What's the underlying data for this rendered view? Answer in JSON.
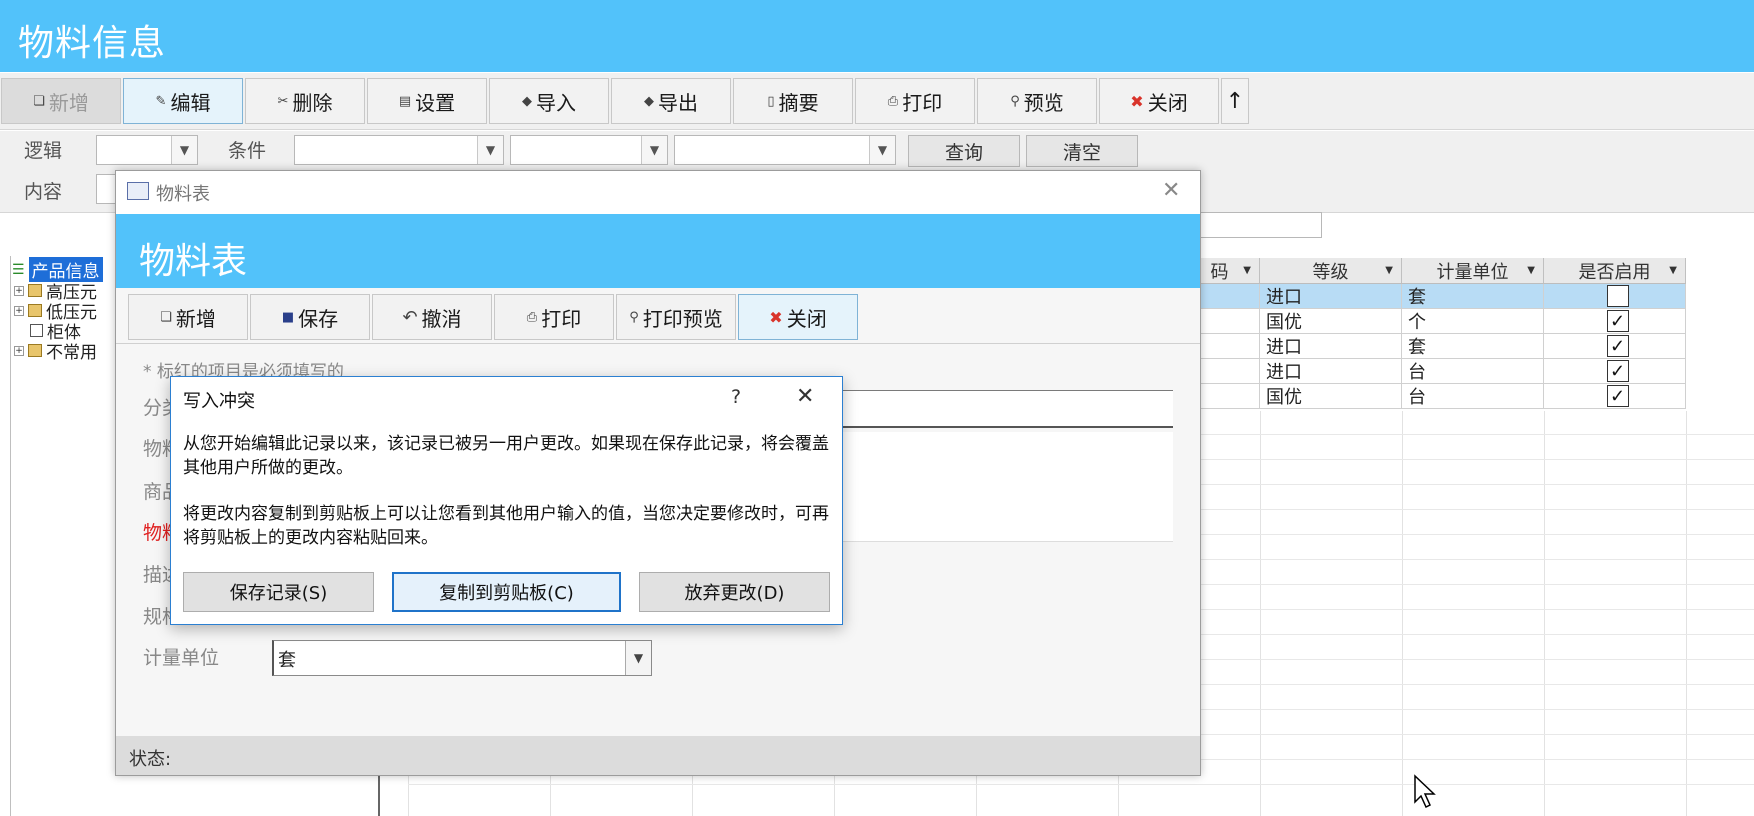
{
  "app": {
    "title": "物料信息"
  },
  "toolbar": {
    "buttons": [
      {
        "label": "新增",
        "icon": "new-icon",
        "glyph": "❏"
      },
      {
        "label": "编辑",
        "icon": "edit-icon",
        "glyph": "✎"
      },
      {
        "label": "删除",
        "icon": "delete-icon",
        "glyph": "✂"
      },
      {
        "label": "设置",
        "icon": "settings-icon",
        "glyph": "▤"
      },
      {
        "label": "导入",
        "icon": "import-icon",
        "glyph": "◆"
      },
      {
        "label": "导出",
        "icon": "export-icon",
        "glyph": "◆"
      },
      {
        "label": "摘要",
        "icon": "summary-icon",
        "glyph": "▯"
      },
      {
        "label": "打印",
        "icon": "print-icon",
        "glyph": "⎙"
      },
      {
        "label": "预览",
        "icon": "preview-icon",
        "glyph": "⚲"
      },
      {
        "label": "关闭",
        "icon": "close-circle-icon",
        "glyph": "✖"
      }
    ],
    "scroll_up": "↑"
  },
  "filter": {
    "logic_label": "逻辑",
    "condition_label": "条件",
    "content_label": "内容",
    "query_button": "查询",
    "clear_button": "清空"
  },
  "tree": {
    "root": "产品信息",
    "items": [
      {
        "label": "高压元",
        "type": "folder",
        "expandable": true
      },
      {
        "label": "低压元",
        "type": "folder",
        "expandable": true
      },
      {
        "label": "柜体",
        "type": "leaf",
        "expandable": false
      },
      {
        "label": "不常用",
        "type": "folder",
        "expandable": true
      }
    ]
  },
  "grid": {
    "columns": [
      "码",
      "等级",
      "计量单位",
      "是否启用"
    ],
    "rows": [
      {
        "grade": "进口",
        "unit": "套",
        "enabled": false,
        "selected": true
      },
      {
        "grade": "国优",
        "unit": "个",
        "enabled": true,
        "selected": false
      },
      {
        "grade": "进口",
        "unit": "套",
        "enabled": true,
        "selected": false
      },
      {
        "grade": "进口",
        "unit": "台",
        "enabled": true,
        "selected": false
      },
      {
        "grade": "国优",
        "unit": "台",
        "enabled": true,
        "selected": false
      }
    ]
  },
  "form_window": {
    "title": "物料表",
    "banner": "物料表",
    "close_glyph": "✕",
    "buttons": [
      {
        "label": "新增",
        "glyph": "❏"
      },
      {
        "label": "保存",
        "glyph": "■"
      },
      {
        "label": "撤消",
        "glyph": "↶"
      },
      {
        "label": "打印",
        "glyph": "⎙"
      },
      {
        "label": "打印预览",
        "glyph": "⚲"
      },
      {
        "label": "关闭",
        "glyph": "✖"
      }
    ],
    "required_note": "* 标红的项目是必须填写的",
    "labels": {
      "category": "分类",
      "code": "物料",
      "product": "商品",
      "name": "物料",
      "desc": "描述",
      "spec": "规格",
      "unit": "计量单位"
    },
    "unit_value": "套",
    "status_label": "状态:"
  },
  "dialog": {
    "title": "写入冲突",
    "help": "?",
    "close": "✕",
    "message1": "从您开始编辑此记录以来，该记录已被另一用户更改。如果现在保存此记录，将会覆盖其他用户所做的更改。",
    "message2": "将更改内容复制到剪贴板上可以让您看到其他用户输入的值，当您决定要修改时，可再将剪贴板上的更改内容粘贴回来。",
    "save_button": "保存记录(S)",
    "copy_button": "复制到剪贴板(C)",
    "discard_button": "放弃更改(D)"
  }
}
